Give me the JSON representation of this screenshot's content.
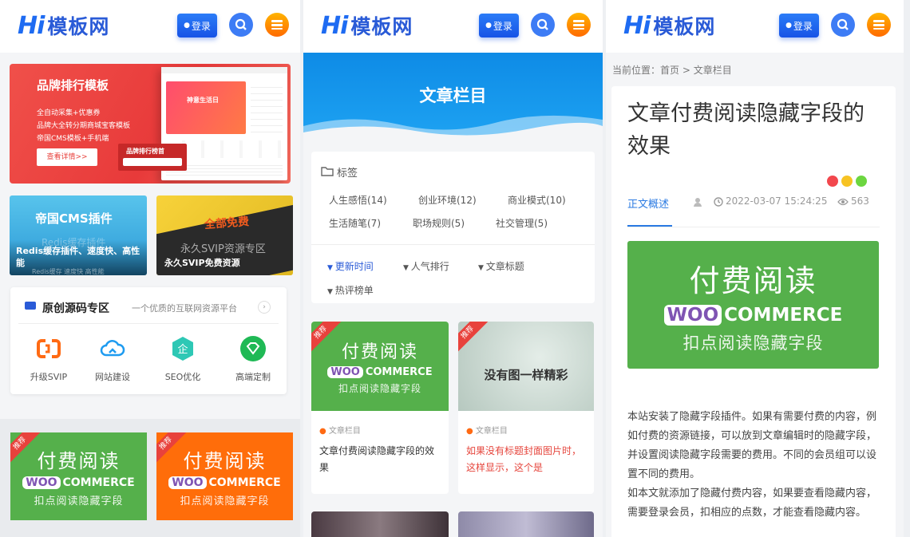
{
  "brand": {
    "logo_hi": "Hi",
    "logo_name": "模板网"
  },
  "header": {
    "login_label": "登录"
  },
  "colors": {
    "blue": "#1e6bf2",
    "green": "#55b04b",
    "orange": "#ff6d0a",
    "red": "#e6463d"
  },
  "home": {
    "banner": {
      "title": "品牌排行模板",
      "lines": [
        "全自动采集+优惠券",
        "品牌大全转分期商城宝客模板",
        "帝国CMS模板+手机端"
      ],
      "button": "查看详情>>",
      "mock_heading": "神意生活日",
      "mock_sub": "品牌排行榜首"
    },
    "tiles": [
      {
        "big": "帝国CMS插件",
        "ghost": "Redis缓存插件",
        "caption": "Redis缓存插件、速度快、高性能",
        "sub": "Redis缓存   速度快   高性能"
      },
      {
        "big": "全部免费",
        "ghost": "永久SVIP资源专区",
        "caption": "永久SVIP免费资源"
      }
    ],
    "source": {
      "title": "原创源码专区",
      "subtitle": "一个优质的互联网资源平台",
      "items": [
        {
          "label": "升级SVIP",
          "icon": "svip-icon"
        },
        {
          "label": "网站建设",
          "icon": "cloud-icon"
        },
        {
          "label": "SEO优化",
          "icon": "seo-icon"
        },
        {
          "label": "高端定制",
          "icon": "diamond-icon"
        }
      ]
    },
    "promos": [
      {
        "title": "付费阅读",
        "brand_box": "WOO",
        "brand_text": "COMMERCE",
        "sub": "扣点阅读隐藏字段",
        "ribbon": "推荐"
      },
      {
        "title": "付费阅读",
        "brand_box": "WOO",
        "brand_text": "COMMERCE",
        "sub": "扣点阅读隐藏字段",
        "ribbon": "推荐"
      }
    ]
  },
  "category": {
    "banner_title": "文章栏目",
    "tags_heading": "标签",
    "tags": [
      "人生感悟(14)",
      "创业环境(12)",
      "商业模式(10)",
      "生活随笔(7)",
      "职场规则(5)",
      "社交管理(5)"
    ],
    "sorts": [
      "更新时间",
      "人气排行",
      "文章标题",
      "热评榜单"
    ],
    "articles": [
      {
        "category": "文章栏目",
        "title": "文章付费阅读隐藏字段的效果",
        "cover_title": "付费阅读",
        "brand_box": "WOO",
        "brand_text": "COMMERCE",
        "cover_sub": "扣点阅读隐藏字段",
        "ribbon": "推荐"
      },
      {
        "category": "文章栏目",
        "title": "如果没有标题封面图片时，这样显示，这个是",
        "cover_title": "没有图一样精彩",
        "ribbon": "推荐"
      }
    ]
  },
  "article": {
    "breadcrumb": {
      "prefix": "当前位置：",
      "home": "首页",
      "sep": ">",
      "current": "文章栏目"
    },
    "title": "文章付费阅读隐藏字段的效果",
    "tab": "正文概述",
    "date": "2022-03-07 15:24:25",
    "views": "563",
    "hero": {
      "title": "付费阅读",
      "brand_box": "WOO",
      "brand_text": "COMMERCE",
      "sub": "扣点阅读隐藏字段"
    },
    "paragraphs": [
      "本站安装了隐藏字段插件。如果有需要付费的内容，例如付费的资源链接，可以放到文章编辑时的隐藏字段，并设置阅读隐藏字段需要的费用。不同的会员组可以设置不同的费用。",
      "如本文就添加了隐藏付费内容，如果要查看隐藏内容，需要登录会员，扣相应的点数，才能查看隐藏内容。"
    ]
  }
}
